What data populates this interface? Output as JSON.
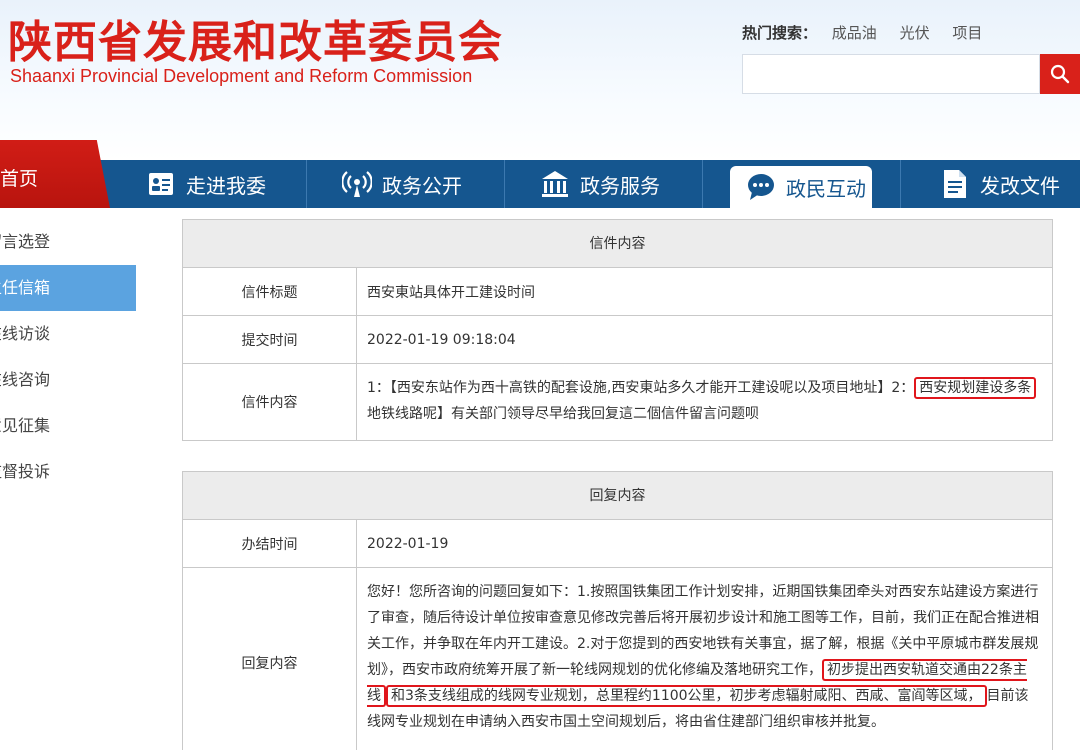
{
  "header": {
    "title_cn": "陕西省发展和改革委员会",
    "title_en": "Shaanxi Provincial Development and Reform Commission",
    "hot_search_label": "热门搜索：",
    "hot_search_items": [
      "成品油",
      "光伏",
      "项目"
    ],
    "search_placeholder": ""
  },
  "nav": {
    "home": "首页",
    "items": [
      "走进我委",
      "政务公开",
      "政务服务",
      "政民互动",
      "发改文件"
    ],
    "active": "政民互动"
  },
  "sidebar": {
    "items": [
      "留言选登",
      "主任信箱",
      "在线访谈",
      "在线咨询",
      "意见征集",
      "监督投诉"
    ],
    "active": "主任信箱"
  },
  "letter": {
    "section_title": "信件内容",
    "title_label": "信件标题",
    "title_value": "西安東站具体开工建设时间",
    "time_label": "提交时间",
    "time_value": "2022-01-19 09:18:04",
    "content_label": "信件内容",
    "content_a": "1：【西安东站作为西十高铁的配套设施,西安東站多久才能开工建设呢以及项目地址】2：",
    "content_highlight": "西安规划建设多条",
    "content_b": "地铁线路呢】有关部门领导尽早给我回复這二個信件留言问题呗"
  },
  "reply": {
    "section_title": "回复内容",
    "date_label": "办结时间",
    "date_value": "2022-01-19",
    "content_label": "回复内容",
    "content_a": "您好！您所咨询的问题回复如下：1.按照国铁集团工作计划安排，近期国铁集团牵头对西安东站建设方案进行了审查，随后待设计单位按审查意见修改完善后将开展初步设计和施工图等工作，目前，我们正在配合推进相关工作，并争取在年内开工建设。2.对于您提到的西安地铁有关事宜，据了解，根据《关中平原城市群发展规划》，西安市政府统筹开展了新一轮线网规划的优化修编及落地研究工作，",
    "content_highlight1": "初步提出西安轨道交通由22条主线",
    "content_highlight2": "和3条支线组成的线网专业规划，总里程约1100公里，初步考虑辐射咸阳、西咸、富阎等区域，",
    "content_b": "目前该线网专业规划在申请纳入西安市国土空间规划后，将由省住建部门组织审核并批复。"
  },
  "colors": {
    "brand_red": "#d9211a",
    "nav_blue": "#15568f",
    "sidebar_active": "#5ba3e0",
    "highlight_red": "#e0161c"
  },
  "icons": [
    "search-icon",
    "id-card-icon",
    "broadcast-icon",
    "building-icon",
    "chat-bubble-icon",
    "document-icon"
  ]
}
